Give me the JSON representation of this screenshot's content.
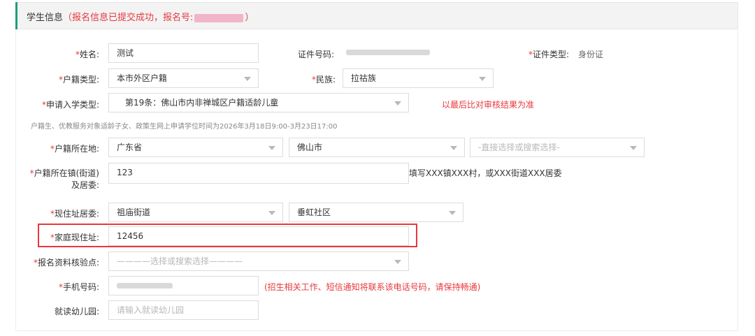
{
  "header": {
    "title": "学生信息",
    "status_prefix": "（报名信息已提交成功，报名号:",
    "status_suffix": "）"
  },
  "form": {
    "name": {
      "label": "姓名:",
      "value": "测试"
    },
    "id_number": {
      "label": "证件号码:"
    },
    "id_type": {
      "label": "证件类型:",
      "value": "身份证"
    },
    "hukou_type": {
      "label": "户籍类型:",
      "value": "本市外区户籍"
    },
    "ethnicity": {
      "label": "民族:",
      "value": "拉祜族"
    },
    "apply_type": {
      "label": "申请入学类型:",
      "value": "第19条：佛山市内非禅城区户籍适龄儿童",
      "note": "以最后比对审核结果为准"
    },
    "apply_hint": "户籍生、优教服务对象适龄子女、政策生网上申请学位时间为2026年3月18日9:00-3月23日17:00",
    "hukou_location": {
      "label": "户籍所在地:",
      "province": "广东省",
      "city": "佛山市",
      "district_placeholder": "-直接选择或搜索选择-"
    },
    "hukou_town": {
      "label_line1": "户籍所在镇(街道)",
      "label_line2": "及居委:",
      "value": "123",
      "hint": "填写XXX镇XXX村，或XXX街道XXX居委"
    },
    "current_committee": {
      "label": "现住址居委:",
      "street": "祖庙街道",
      "community": "垂虹社区"
    },
    "home_address": {
      "label": "家庭现住址:",
      "value": "12456"
    },
    "verify_point": {
      "label": "报名资料核验点:",
      "placeholder": "————选择或搜索选择————"
    },
    "phone": {
      "label": "手机号码:",
      "note": "(招生相关工作、短信通知将联系该电话号码，请保持畅通)"
    },
    "kindergarten": {
      "label": "就读幼儿园:",
      "placeholder": "请输入就读幼儿园"
    }
  },
  "colors": {
    "accent": "#1aa07a",
    "required": "#e8383d",
    "highlight": "#e8383d"
  }
}
